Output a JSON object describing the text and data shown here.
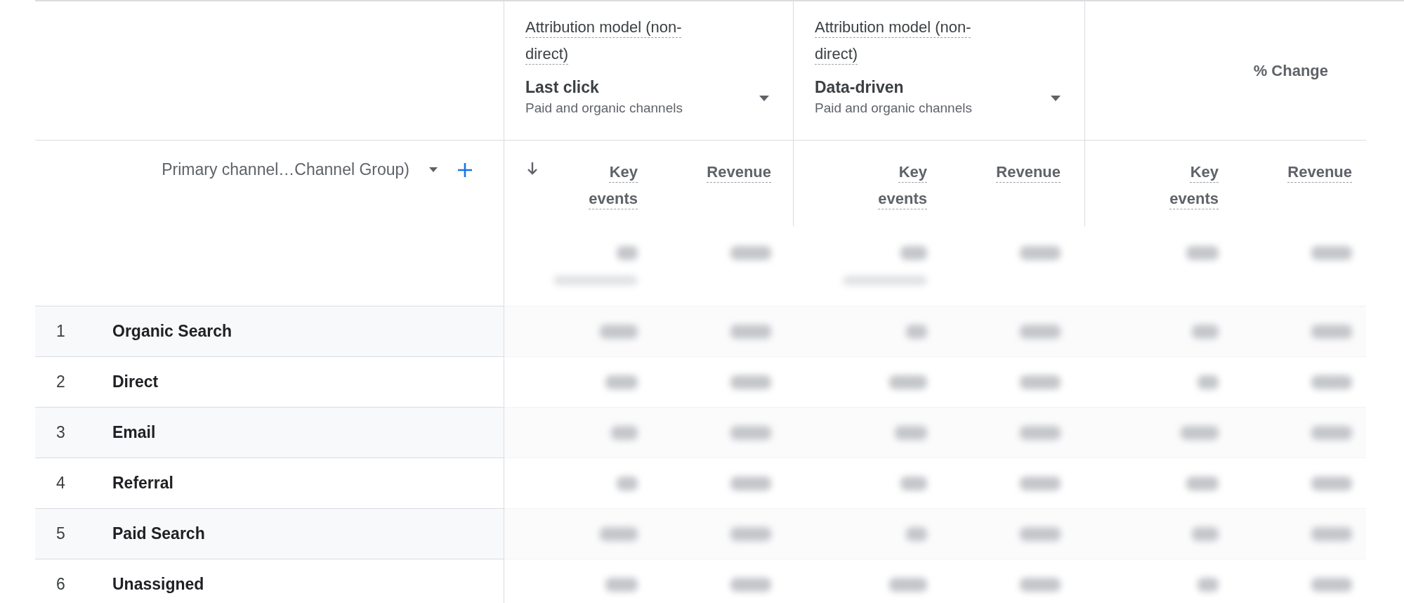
{
  "dimension": {
    "label": "Primary channel…Channel Group)"
  },
  "groups": [
    {
      "kind": "model",
      "title": "Attribution model (non-direct)",
      "model": "Last click",
      "scope": "Paid and organic channels",
      "metrics": [
        {
          "label": "Key events",
          "sorted": true
        },
        {
          "label": "Revenue",
          "sorted": false
        }
      ]
    },
    {
      "kind": "model",
      "title": "Attribution model (non-direct)",
      "model": "Data-driven",
      "scope": "Paid and organic channels",
      "metrics": [
        {
          "label": "Key events",
          "sorted": false
        },
        {
          "label": "Revenue",
          "sorted": false
        }
      ]
    },
    {
      "kind": "change",
      "title": "% Change",
      "metrics": [
        {
          "label": "Key events",
          "sorted": false
        },
        {
          "label": "Revenue",
          "sorted": false
        }
      ]
    }
  ],
  "rows": [
    {
      "rank": "1",
      "channel": "Organic Search"
    },
    {
      "rank": "2",
      "channel": "Direct"
    },
    {
      "rank": "3",
      "channel": "Email"
    },
    {
      "rank": "4",
      "channel": "Referral"
    },
    {
      "rank": "5",
      "channel": "Paid Search"
    },
    {
      "rank": "6",
      "channel": "Unassigned"
    }
  ]
}
